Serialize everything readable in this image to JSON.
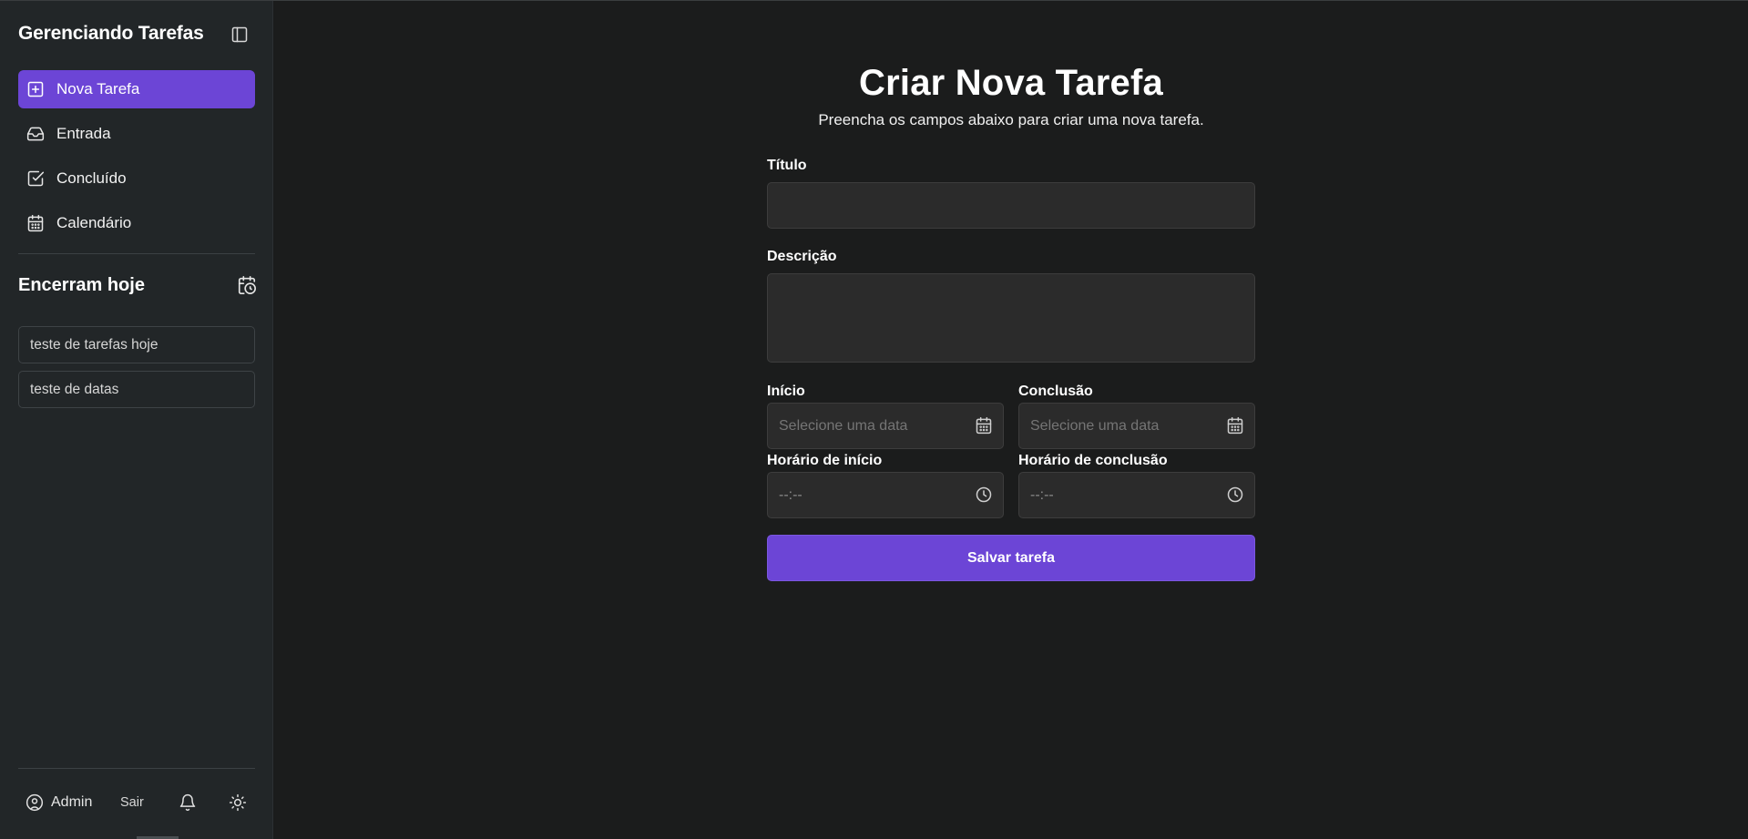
{
  "sidebar": {
    "brand": "Gerenciando Tarefas",
    "nav": [
      {
        "label": "Nova Tarefa",
        "icon": "plus-square-icon",
        "active": true
      },
      {
        "label": "Entrada",
        "icon": "inbox-icon",
        "active": false
      },
      {
        "label": "Concluído",
        "icon": "check-square-icon",
        "active": false
      },
      {
        "label": "Calendário",
        "icon": "calendar-icon",
        "active": false
      }
    ],
    "today_title": "Encerram hoje",
    "today_items": [
      "teste de tarefas hoje",
      "teste de datas"
    ],
    "footer": {
      "user": "Admin",
      "logout": "Sair"
    }
  },
  "form": {
    "title": "Criar Nova Tarefa",
    "subtitle": "Preencha os campos abaixo para criar uma nova tarefa.",
    "title_label": "Título",
    "title_value": "",
    "desc_label": "Descrição",
    "desc_value": "",
    "start_label": "Início",
    "start_placeholder": "Selecione uma data",
    "end_label": "Conclusão",
    "end_placeholder": "Selecione uma data",
    "start_time_label": "Horário de início",
    "start_time_value": "--:--",
    "end_time_label": "Horário de conclusão",
    "end_time_value": "--:--",
    "save_label": "Salvar tarefa"
  },
  "colors": {
    "accent": "#6c45d6",
    "sidebar_bg": "#222628",
    "main_bg": "#1b1c1c",
    "field_bg": "#2b2b2b"
  }
}
